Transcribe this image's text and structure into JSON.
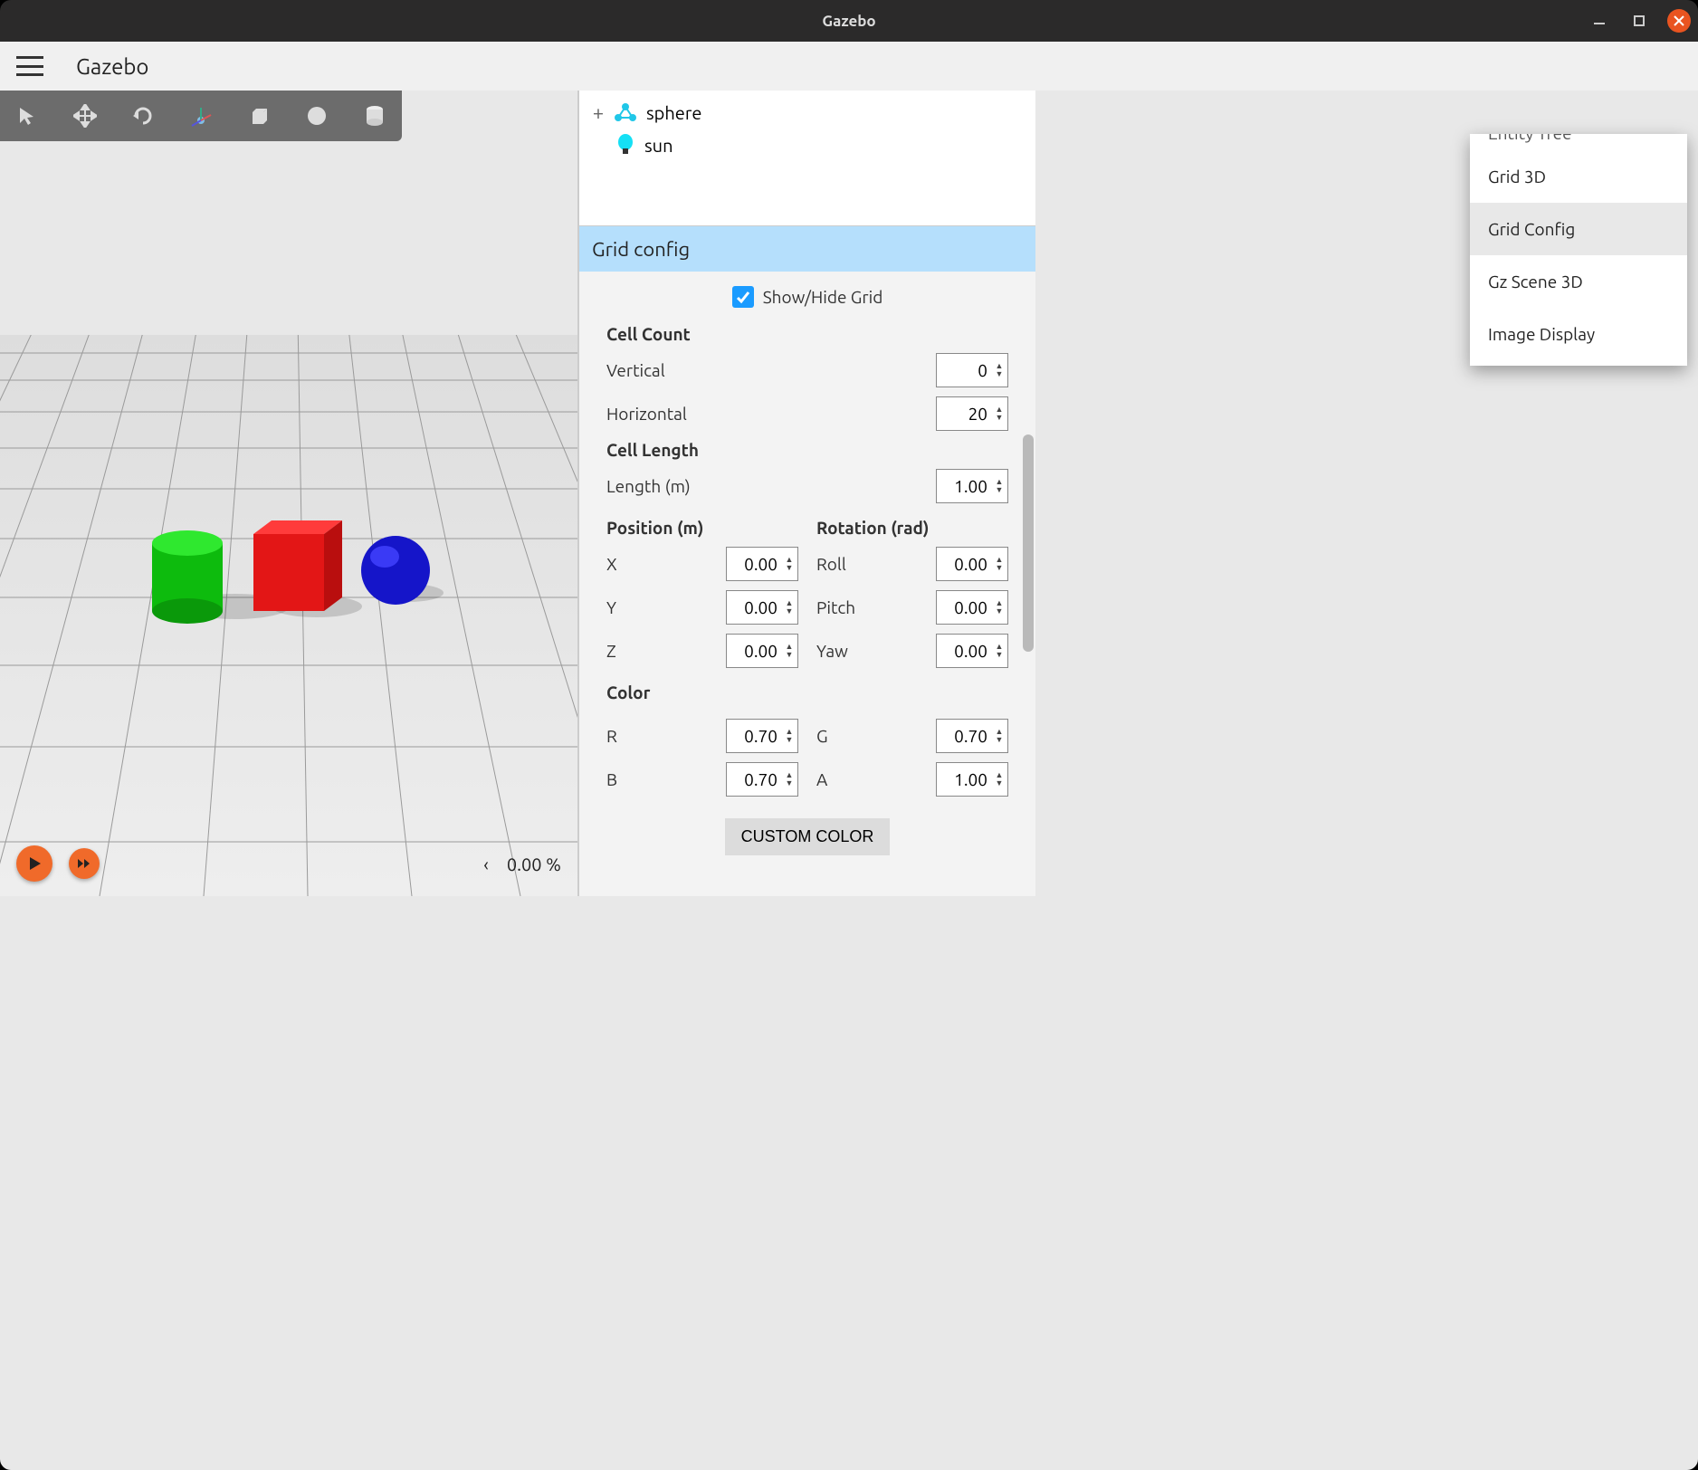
{
  "window": {
    "title": "Gazebo"
  },
  "menubar": {
    "app_name": "Gazebo"
  },
  "viewport": {
    "status_percent": "0.00 %"
  },
  "entity_tree": {
    "items": [
      {
        "label": "sphere",
        "icon": "model-icon",
        "expandable": true
      },
      {
        "label": "sun",
        "icon": "light-icon",
        "expandable": false
      }
    ]
  },
  "panel": {
    "title": "Grid config",
    "show_hide_label": "Show/Hide Grid",
    "show_hide_checked": true,
    "sections": {
      "cell_count": {
        "title": "Cell Count",
        "vertical_label": "Vertical",
        "vertical_value": "0",
        "horizontal_label": "Horizontal",
        "horizontal_value": "20"
      },
      "cell_length": {
        "title": "Cell Length",
        "length_label": "Length (m)",
        "length_value": "1.00"
      },
      "position": {
        "title": "Position (m)",
        "x_label": "X",
        "x_value": "0.00",
        "y_label": "Y",
        "y_value": "0.00",
        "z_label": "Z",
        "z_value": "0.00"
      },
      "rotation": {
        "title": "Rotation (rad)",
        "roll_label": "Roll",
        "roll_value": "0.00",
        "pitch_label": "Pitch",
        "pitch_value": "0.00",
        "yaw_label": "Yaw",
        "yaw_value": "0.00"
      },
      "color": {
        "title": "Color",
        "r_label": "R",
        "r_value": "0.70",
        "g_label": "G",
        "g_value": "0.70",
        "b_label": "B",
        "b_value": "0.70",
        "a_label": "A",
        "a_value": "1.00"
      }
    },
    "custom_color_label": "CUSTOM COLOR"
  },
  "dropdown": {
    "items": [
      {
        "label": "Entity Tree",
        "truncated": true
      },
      {
        "label": "Grid 3D"
      },
      {
        "label": "Grid Config",
        "hovered": true
      },
      {
        "label": "Gz Scene 3D"
      },
      {
        "label": "Image Display"
      }
    ]
  }
}
